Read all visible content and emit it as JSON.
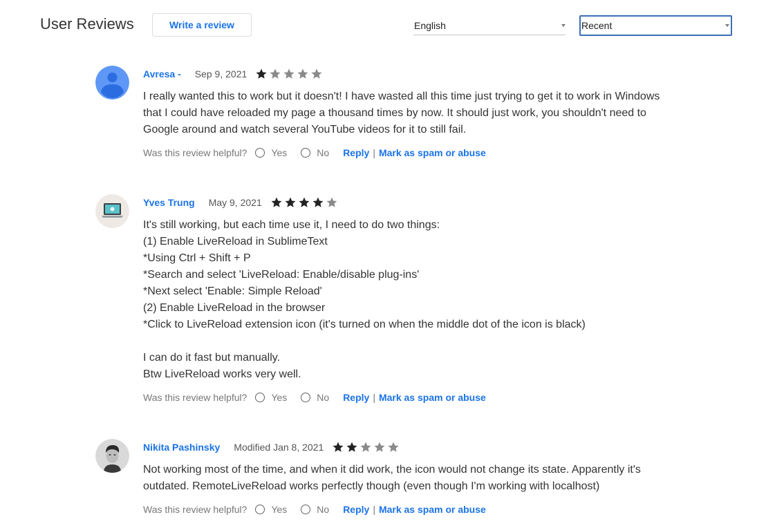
{
  "header": {
    "title": "User Reviews",
    "write_review_label": "Write a review",
    "language_select": {
      "value": "English"
    },
    "sort_select": {
      "value": "Recent"
    }
  },
  "colors": {
    "link": "#1a73e8",
    "star_filled": "#222222",
    "star_empty": "#8a8a8a",
    "sort_border": "#3b6fb6"
  },
  "common": {
    "helpful_question": "Was this review helpful?",
    "yes_label": "Yes",
    "no_label": "No",
    "reply_label": "Reply",
    "separator": "|",
    "spam_label": "Mark as spam or abuse"
  },
  "reviews": [
    {
      "author": "Avresa -",
      "date": "Sep 9, 2021",
      "rating": 1,
      "avatar": "default-person-avatar",
      "lines": [
        "I really wanted this to work but it doesn't! I have wasted all this time just trying to get it to work in Windows",
        "that I could have reloaded my page a thousand times by now. It should just work, you shouldn't need to",
        "Google around and watch several YouTube videos for it to still fail."
      ]
    },
    {
      "author": "Yves Trung",
      "date": "May 9, 2021",
      "rating": 4,
      "avatar": "laptop-avatar",
      "lines": [
        "It's still working, but each time use it, I need to do two things:",
        "(1) Enable LiveReload in SublimeText",
        "*Using Ctrl + Shift + P",
        "*Search and select 'LiveReload: Enable/disable plug-ins'",
        "*Next select 'Enable: Simple Reload'",
        "(2) Enable LiveReload in the browser",
        "*Click to LiveReload extension icon (it's turned on when the middle dot of the icon is black)",
        "",
        "I can do it fast but manually.",
        "Btw LiveReload works very well."
      ]
    },
    {
      "author": "Nikita Pashinsky",
      "date": "Modified Jan 8, 2021",
      "rating": 2,
      "avatar": "photo-avatar",
      "lines": [
        "Not working most of the time, and when it did work, the icon would not change its state. Apparently it's",
        "outdated. RemoteLiveReload works perfectly though (even though I'm working with localhost)"
      ]
    }
  ]
}
